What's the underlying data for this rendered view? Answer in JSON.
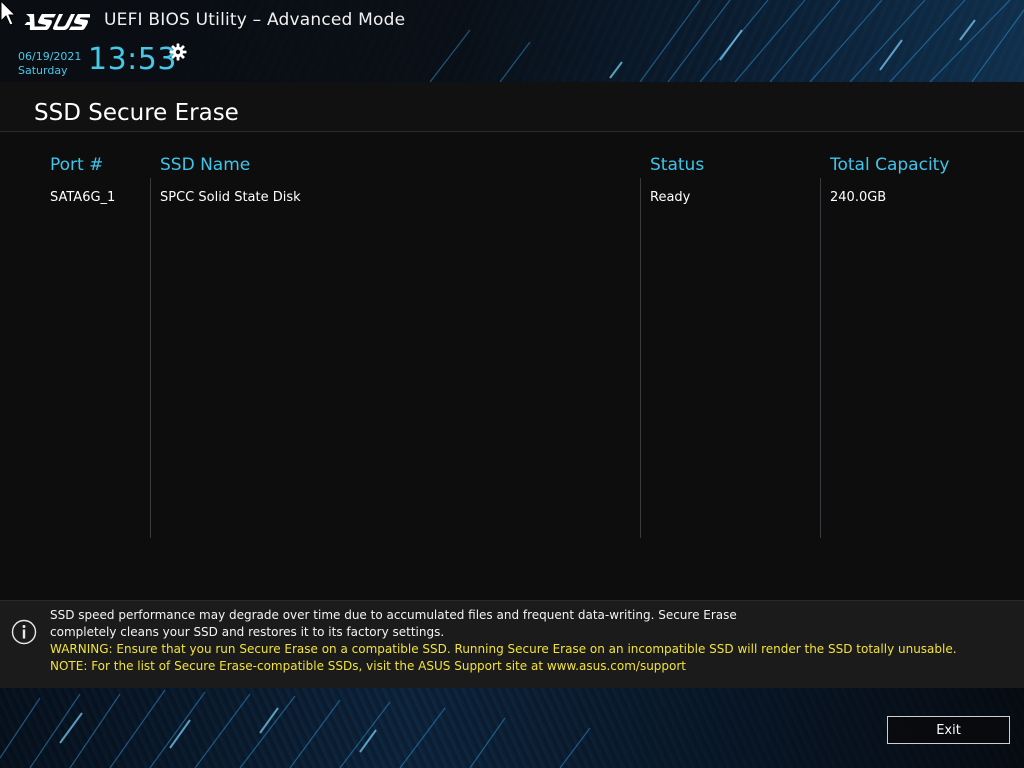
{
  "header": {
    "brand": "ASUS",
    "title": "UEFI BIOS Utility – Advanced Mode",
    "date": "06/19/2021",
    "day": "Saturday",
    "time": "13:53"
  },
  "page": {
    "title": "SSD Secure Erase"
  },
  "table": {
    "columns": [
      "Port #",
      "SSD Name",
      "Status",
      "Total Capacity"
    ],
    "rows": [
      [
        "SATA6G_1",
        "SPCC Solid State Disk",
        "Ready",
        "240.0GB"
      ]
    ]
  },
  "info": {
    "line1": "SSD speed performance may degrade over time due to accumulated files and frequent data-writing. Secure Erase",
    "line2": "completely cleans your SSD and restores it to its factory settings.",
    "warning": "WARNING: Ensure that you run Secure Erase on a compatible SSD. Running Secure Erase on an incompatible SSD will render the SSD totally unusable.",
    "note": "NOTE: For the list of Secure Erase-compatible SSDs, visit the ASUS Support site at www.asus.com/support"
  },
  "footer": {
    "exit_label": "Exit"
  },
  "colors": {
    "accent_cyan": "#3fc5ea",
    "warning_yellow": "#f2e23a",
    "background": "#0d0d0e"
  },
  "icons": {
    "settings": "gear-icon",
    "info": "info-icon",
    "pointer": "mouse-cursor-icon"
  }
}
